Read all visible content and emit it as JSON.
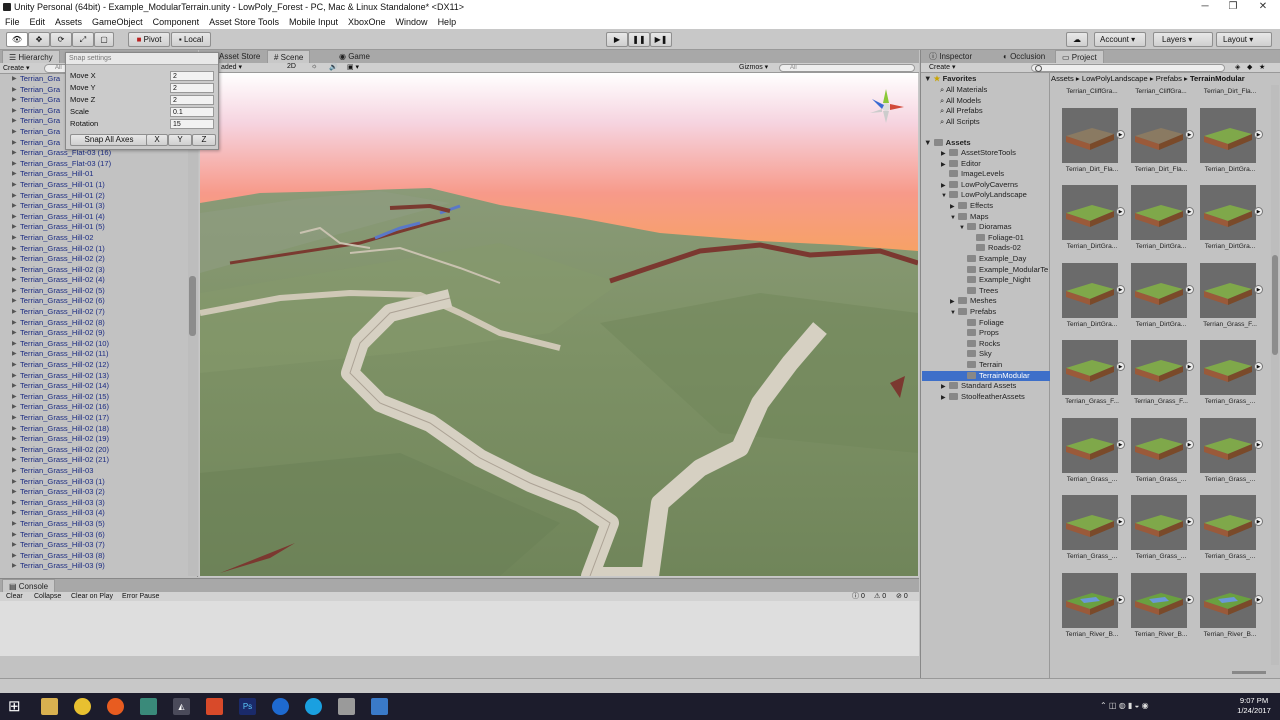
{
  "window": {
    "title": "Unity Personal (64bit) - Example_ModularTerrain.unity - LowPoly_Forest - PC, Mac & Linux Standalone* <DX11>",
    "controls": [
      "─",
      "❐",
      "✕"
    ]
  },
  "menu": [
    "File",
    "Edit",
    "Assets",
    "GameObject",
    "Component",
    "Asset Store Tools",
    "Mobile Input",
    "XboxOne",
    "Window",
    "Help"
  ],
  "toolbar": {
    "pivot": "Pivot",
    "local": "Local",
    "account": "Account",
    "layers": "Layers",
    "layout": "Layout"
  },
  "hierarchy": {
    "tab": "Hierarchy",
    "create": "Create",
    "search_placeholder": "All",
    "items": [
      "Terrian_Gra",
      "Terrian_Gra",
      "Terrian_Gra",
      "Terrian_Gra",
      "Terrian_Gra",
      "Terrian_Gra",
      "Terrian_Gra",
      "Terrian_Grass_Flat-03 (16)",
      "Terrian_Grass_Flat-03 (17)",
      "Terrian_Grass_Hill-01",
      "Terrian_Grass_Hill-01 (1)",
      "Terrian_Grass_Hill-01 (2)",
      "Terrian_Grass_Hill-01 (3)",
      "Terrian_Grass_Hill-01 (4)",
      "Terrian_Grass_Hill-01 (5)",
      "Terrian_Grass_Hill-02",
      "Terrian_Grass_Hill-02 (1)",
      "Terrian_Grass_Hill-02 (2)",
      "Terrian_Grass_Hill-02 (3)",
      "Terrian_Grass_Hill-02 (4)",
      "Terrian_Grass_Hill-02 (5)",
      "Terrian_Grass_Hill-02 (6)",
      "Terrian_Grass_Hill-02 (7)",
      "Terrian_Grass_Hill-02 (8)",
      "Terrian_Grass_Hill-02 (9)",
      "Terrian_Grass_Hill-02 (10)",
      "Terrian_Grass_Hill-02 (11)",
      "Terrian_Grass_Hill-02 (12)",
      "Terrian_Grass_Hill-02 (13)",
      "Terrian_Grass_Hill-02 (14)",
      "Terrian_Grass_Hill-02 (15)",
      "Terrian_Grass_Hill-02 (16)",
      "Terrian_Grass_Hill-02 (17)",
      "Terrian_Grass_Hill-02 (18)",
      "Terrian_Grass_Hill-02 (19)",
      "Terrian_Grass_Hill-02 (20)",
      "Terrian_Grass_Hill-02 (21)",
      "Terrian_Grass_Hill-03",
      "Terrian_Grass_Hill-03 (1)",
      "Terrian_Grass_Hill-03 (2)",
      "Terrian_Grass_Hill-03 (3)",
      "Terrian_Grass_Hill-03 (4)",
      "Terrian_Grass_Hill-03 (5)",
      "Terrian_Grass_Hill-03 (6)",
      "Terrian_Grass_Hill-03 (7)",
      "Terrian_Grass_Hill-03 (8)",
      "Terrian_Grass_Hill-03 (9)"
    ]
  },
  "snap": {
    "title": "Snap settings",
    "rows": [
      {
        "label": "Move X",
        "value": "2"
      },
      {
        "label": "Move Y",
        "value": "2"
      },
      {
        "label": "Move Z",
        "value": "2"
      },
      {
        "label": "Scale",
        "value": "0.1"
      },
      {
        "label": "Rotation",
        "value": "15"
      }
    ],
    "snap_all": "Snap All Axes",
    "x": "X",
    "y": "Y",
    "z": "Z"
  },
  "scene": {
    "tabs": [
      "Asset Store",
      "Scene",
      "Game"
    ],
    "shading": "aded",
    "mode2d": "2D",
    "gizmos": "Gizmos",
    "search_placeholder": "All"
  },
  "console": {
    "tab": "Console",
    "buttons": [
      "Clear",
      "Collapse",
      "Clear on Play",
      "Error Pause"
    ],
    "counts": [
      "0",
      "0",
      "0"
    ]
  },
  "right": {
    "tabs": [
      "Inspector",
      "Occlusion",
      "Project"
    ],
    "create": "Create",
    "breadcrumb": [
      "Assets",
      "LowPolyLandscape",
      "Prefabs",
      "TerrainModular"
    ],
    "favorites_label": "Favorites",
    "favorites": [
      "All Materials",
      "All Models",
      "All Prefabs",
      "All Scripts"
    ],
    "assets_label": "Assets",
    "tree": [
      {
        "label": "AssetStoreTools",
        "depth": 1,
        "arrow": "▶"
      },
      {
        "label": "Editor",
        "depth": 1,
        "arrow": "▶"
      },
      {
        "label": "ImageLevels",
        "depth": 1,
        "arrow": ""
      },
      {
        "label": "LowPolyCaverns",
        "depth": 1,
        "arrow": "▶"
      },
      {
        "label": "LowPolyLandscape",
        "depth": 1,
        "arrow": "▼"
      },
      {
        "label": "Effects",
        "depth": 2,
        "arrow": "▶"
      },
      {
        "label": "Maps",
        "depth": 2,
        "arrow": "▼"
      },
      {
        "label": "Dioramas",
        "depth": 3,
        "arrow": "▼"
      },
      {
        "label": "Foliage-01",
        "depth": 4,
        "arrow": ""
      },
      {
        "label": "Roads-02",
        "depth": 4,
        "arrow": ""
      },
      {
        "label": "Example_Day",
        "depth": 3,
        "arrow": ""
      },
      {
        "label": "Example_ModularTe",
        "depth": 3,
        "arrow": ""
      },
      {
        "label": "Example_Night",
        "depth": 3,
        "arrow": ""
      },
      {
        "label": "Trees",
        "depth": 3,
        "arrow": ""
      },
      {
        "label": "Meshes",
        "depth": 2,
        "arrow": "▶"
      },
      {
        "label": "Prefabs",
        "depth": 2,
        "arrow": "▼"
      },
      {
        "label": "Foliage",
        "depth": 3,
        "arrow": ""
      },
      {
        "label": "Props",
        "depth": 3,
        "arrow": ""
      },
      {
        "label": "Rocks",
        "depth": 3,
        "arrow": ""
      },
      {
        "label": "Sky",
        "depth": 3,
        "arrow": ""
      },
      {
        "label": "Terrain",
        "depth": 3,
        "arrow": ""
      },
      {
        "label": "TerrainModular",
        "depth": 3,
        "arrow": ""
      },
      {
        "label": "Standard Assets",
        "depth": 1,
        "arrow": "▶"
      },
      {
        "label": "StoolfeatherAssets",
        "depth": 1,
        "arrow": "▶"
      }
    ],
    "selected_index": 21,
    "thumb_labels": [
      "Terrian_CliffGra...",
      "Terrian_CliffGra...",
      "Terrian_Dirt_Fla...",
      "Terrian_Dirt_Fla...",
      "Terrian_Dirt_Fla...",
      "Terrian_DirtGra...",
      "Terrian_DirtGra...",
      "Terrian_DirtGra...",
      "Terrian_DirtGra...",
      "Terrian_DirtGra...",
      "Terrian_DirtGra...",
      "Terrian_Grass_F...",
      "Terrian_Grass_F...",
      "Terrian_Grass_F...",
      "Terrian_Grass_...",
      "Terrian_Grass_...",
      "Terrian_Grass_...",
      "Terrian_Grass_...",
      "Terrian_Grass_...",
      "Terrian_Grass_...",
      "Terrian_Grass_...",
      "Terrian_River_B...",
      "Terrian_River_B...",
      "Terrian_River_B..."
    ]
  },
  "taskbar": {
    "time": "9:07 PM",
    "date": "1/24/2017"
  }
}
